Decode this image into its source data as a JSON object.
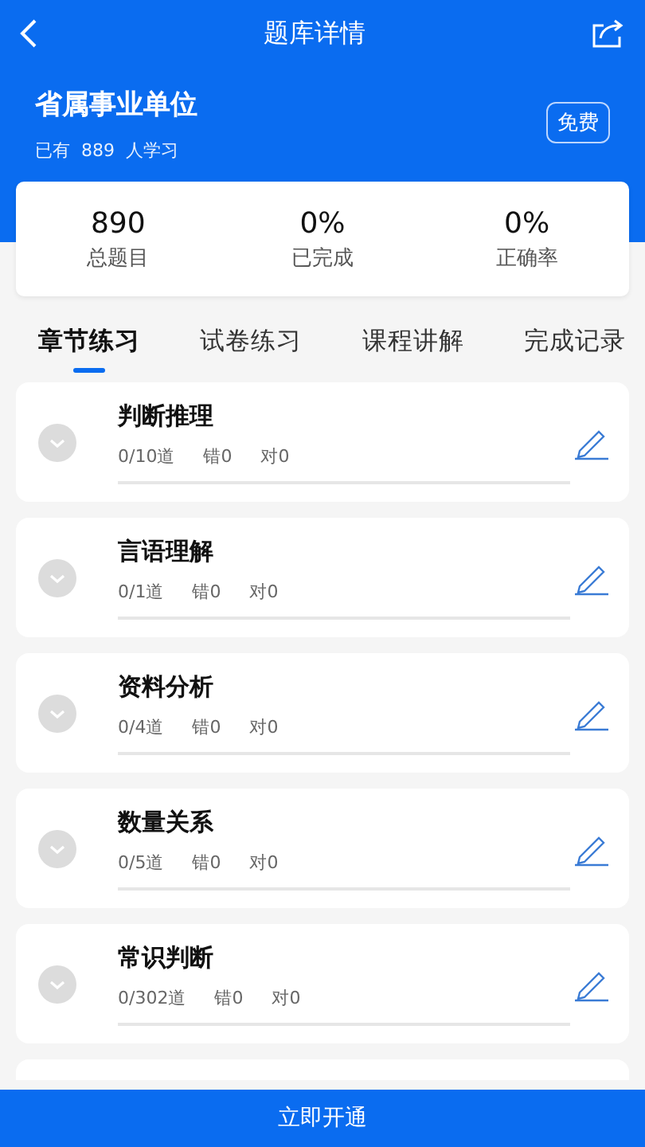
{
  "nav": {
    "title": "题库详情"
  },
  "bank": {
    "name": "省属事业单位",
    "learners_prefix": "已有",
    "learners": "889",
    "learners_suffix": "人学习",
    "badge": "免费"
  },
  "stats": [
    {
      "value": "890",
      "label": "总题目"
    },
    {
      "value": "0%",
      "label": "已完成"
    },
    {
      "value": "0%",
      "label": "正确率"
    }
  ],
  "tabs": [
    {
      "label": "章节练习",
      "selected": true
    },
    {
      "label": "试卷练习",
      "selected": false
    },
    {
      "label": "课程讲解",
      "selected": false
    },
    {
      "label": "完成记录",
      "selected": false
    }
  ],
  "chapters": [
    {
      "title": "判断推理",
      "count": "0/10道",
      "wrong": "错0",
      "right": "对0",
      "level": 0
    },
    {
      "title": "言语理解",
      "count": "0/1道",
      "wrong": "错0",
      "right": "对0",
      "level": 0
    },
    {
      "title": "资料分析",
      "count": "0/4道",
      "wrong": "错0",
      "right": "对0",
      "level": 0
    },
    {
      "title": "数量关系",
      "count": "0/5道",
      "wrong": "错0",
      "right": "对0",
      "level": 0
    },
    {
      "title": "常识判断",
      "count": "0/302道",
      "wrong": "错0",
      "right": "对0",
      "level": 0
    }
  ],
  "bottom_button": "立即开通"
}
